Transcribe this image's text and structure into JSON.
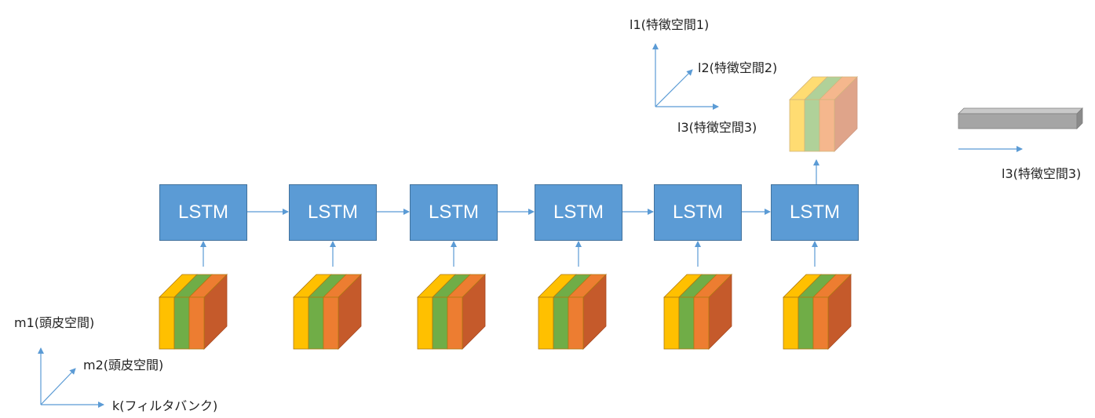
{
  "diagram": {
    "lstm_label": "LSTM",
    "lstm_cell_count": 6,
    "input_axes": {
      "vertical": "m1(頭皮空間)",
      "diagonal": "m2(頭皮空間)",
      "horizontal": "k(フィルタバンク)"
    },
    "feature_axes": {
      "vertical": "l1(特徴空間1)",
      "diagonal": "l2(特徴空間2)",
      "horizontal": "l3(特徴空間3)"
    },
    "vector_axis": {
      "horizontal": "l3(特徴空間3)"
    },
    "colors": {
      "lstm_fill": "#5b9bd5",
      "lstm_border": "#41719c",
      "arrow": "#5b9bd5",
      "slab_yellow": "#ffc000",
      "slab_green": "#70ad47",
      "slab_orange": "#ed7d31",
      "slab_side": "#c55a2b",
      "vector_bar": "#a5a5a5"
    }
  }
}
